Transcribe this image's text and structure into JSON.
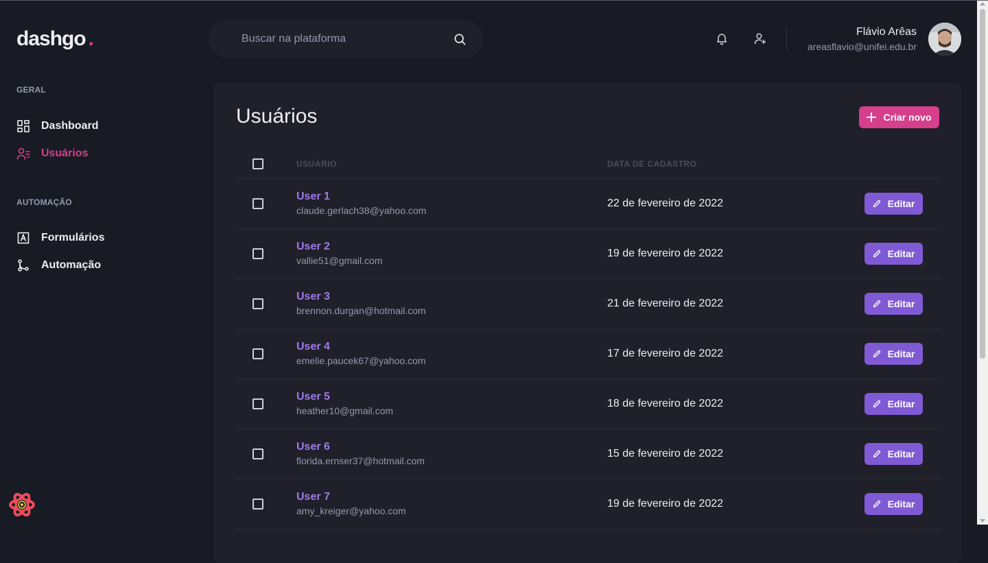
{
  "logo": {
    "text": "dashgo",
    "dot": "."
  },
  "search": {
    "placeholder": "Buscar na plataforma"
  },
  "profile": {
    "name": "Flávio Arêas",
    "email": "areasflavio@unifei.edu.br"
  },
  "sidebar": {
    "sections": [
      {
        "title": "GERAL",
        "items": [
          {
            "label": "Dashboard",
            "icon": "dashboard-icon",
            "active": false
          },
          {
            "label": "Usuários",
            "icon": "users-icon",
            "active": true
          }
        ]
      },
      {
        "title": "AUTOMAÇÃO",
        "items": [
          {
            "label": "Formulários",
            "icon": "form-icon",
            "active": false
          },
          {
            "label": "Automação",
            "icon": "git-merge-icon",
            "active": false
          }
        ]
      }
    ]
  },
  "main": {
    "title": "Usuários",
    "create_label": "Criar novo",
    "columns": [
      "USUÁRIO",
      "DATA DE CADASTRO"
    ],
    "edit_label": "Editar",
    "users": [
      {
        "name": "User 1",
        "email": "claude.gerlach38@yahoo.com",
        "date": "22 de fevereiro de 2022"
      },
      {
        "name": "User 2",
        "email": "vallie51@gmail.com",
        "date": "19 de fevereiro de 2022"
      },
      {
        "name": "User 3",
        "email": "brennon.durgan@hotmail.com",
        "date": "21 de fevereiro de 2022"
      },
      {
        "name": "User 4",
        "email": "emelie.paucek67@yahoo.com",
        "date": "17 de fevereiro de 2022"
      },
      {
        "name": "User 5",
        "email": "heather10@gmail.com",
        "date": "18 de fevereiro de 2022"
      },
      {
        "name": "User 6",
        "email": "florida.ernser37@hotmail.com",
        "date": "15 de fevereiro de 2022"
      },
      {
        "name": "User 7",
        "email": "amy_kreiger@yahoo.com",
        "date": "19 de fevereiro de 2022"
      }
    ]
  },
  "colors": {
    "background": "#181b23",
    "panel": "#1f2029",
    "accent_pink": "#d53f8c",
    "accent_purple": "#805ad5",
    "user_name": "#9f7aea",
    "muted": "#9699b0"
  }
}
